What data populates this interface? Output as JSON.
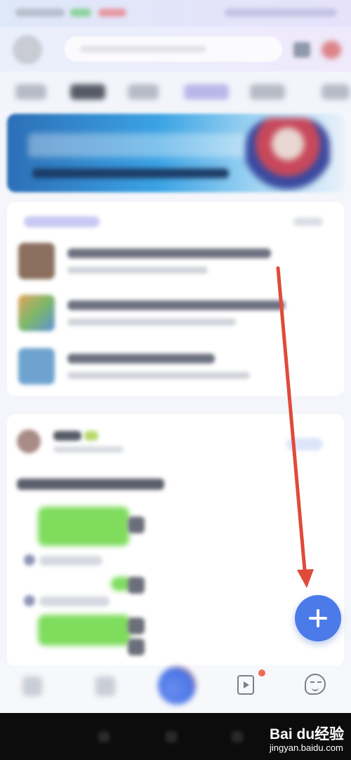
{
  "screen": {
    "accent_color": "#4b7be8",
    "annotation_color": "#e04a3a"
  },
  "header": {
    "search_placeholder": "",
    "icons": [
      "avatar",
      "scan-icon"
    ]
  },
  "fab": {
    "icon": "plus-icon"
  },
  "bottom_nav": {
    "icons": [
      "home-icon",
      "message-icon",
      "center-icon",
      "video-icon",
      "robot-icon"
    ],
    "video_badge_color": "#ee6b58"
  },
  "watermark": {
    "logo_text": "Bai du经验",
    "url": "jingyan.baidu.com"
  }
}
